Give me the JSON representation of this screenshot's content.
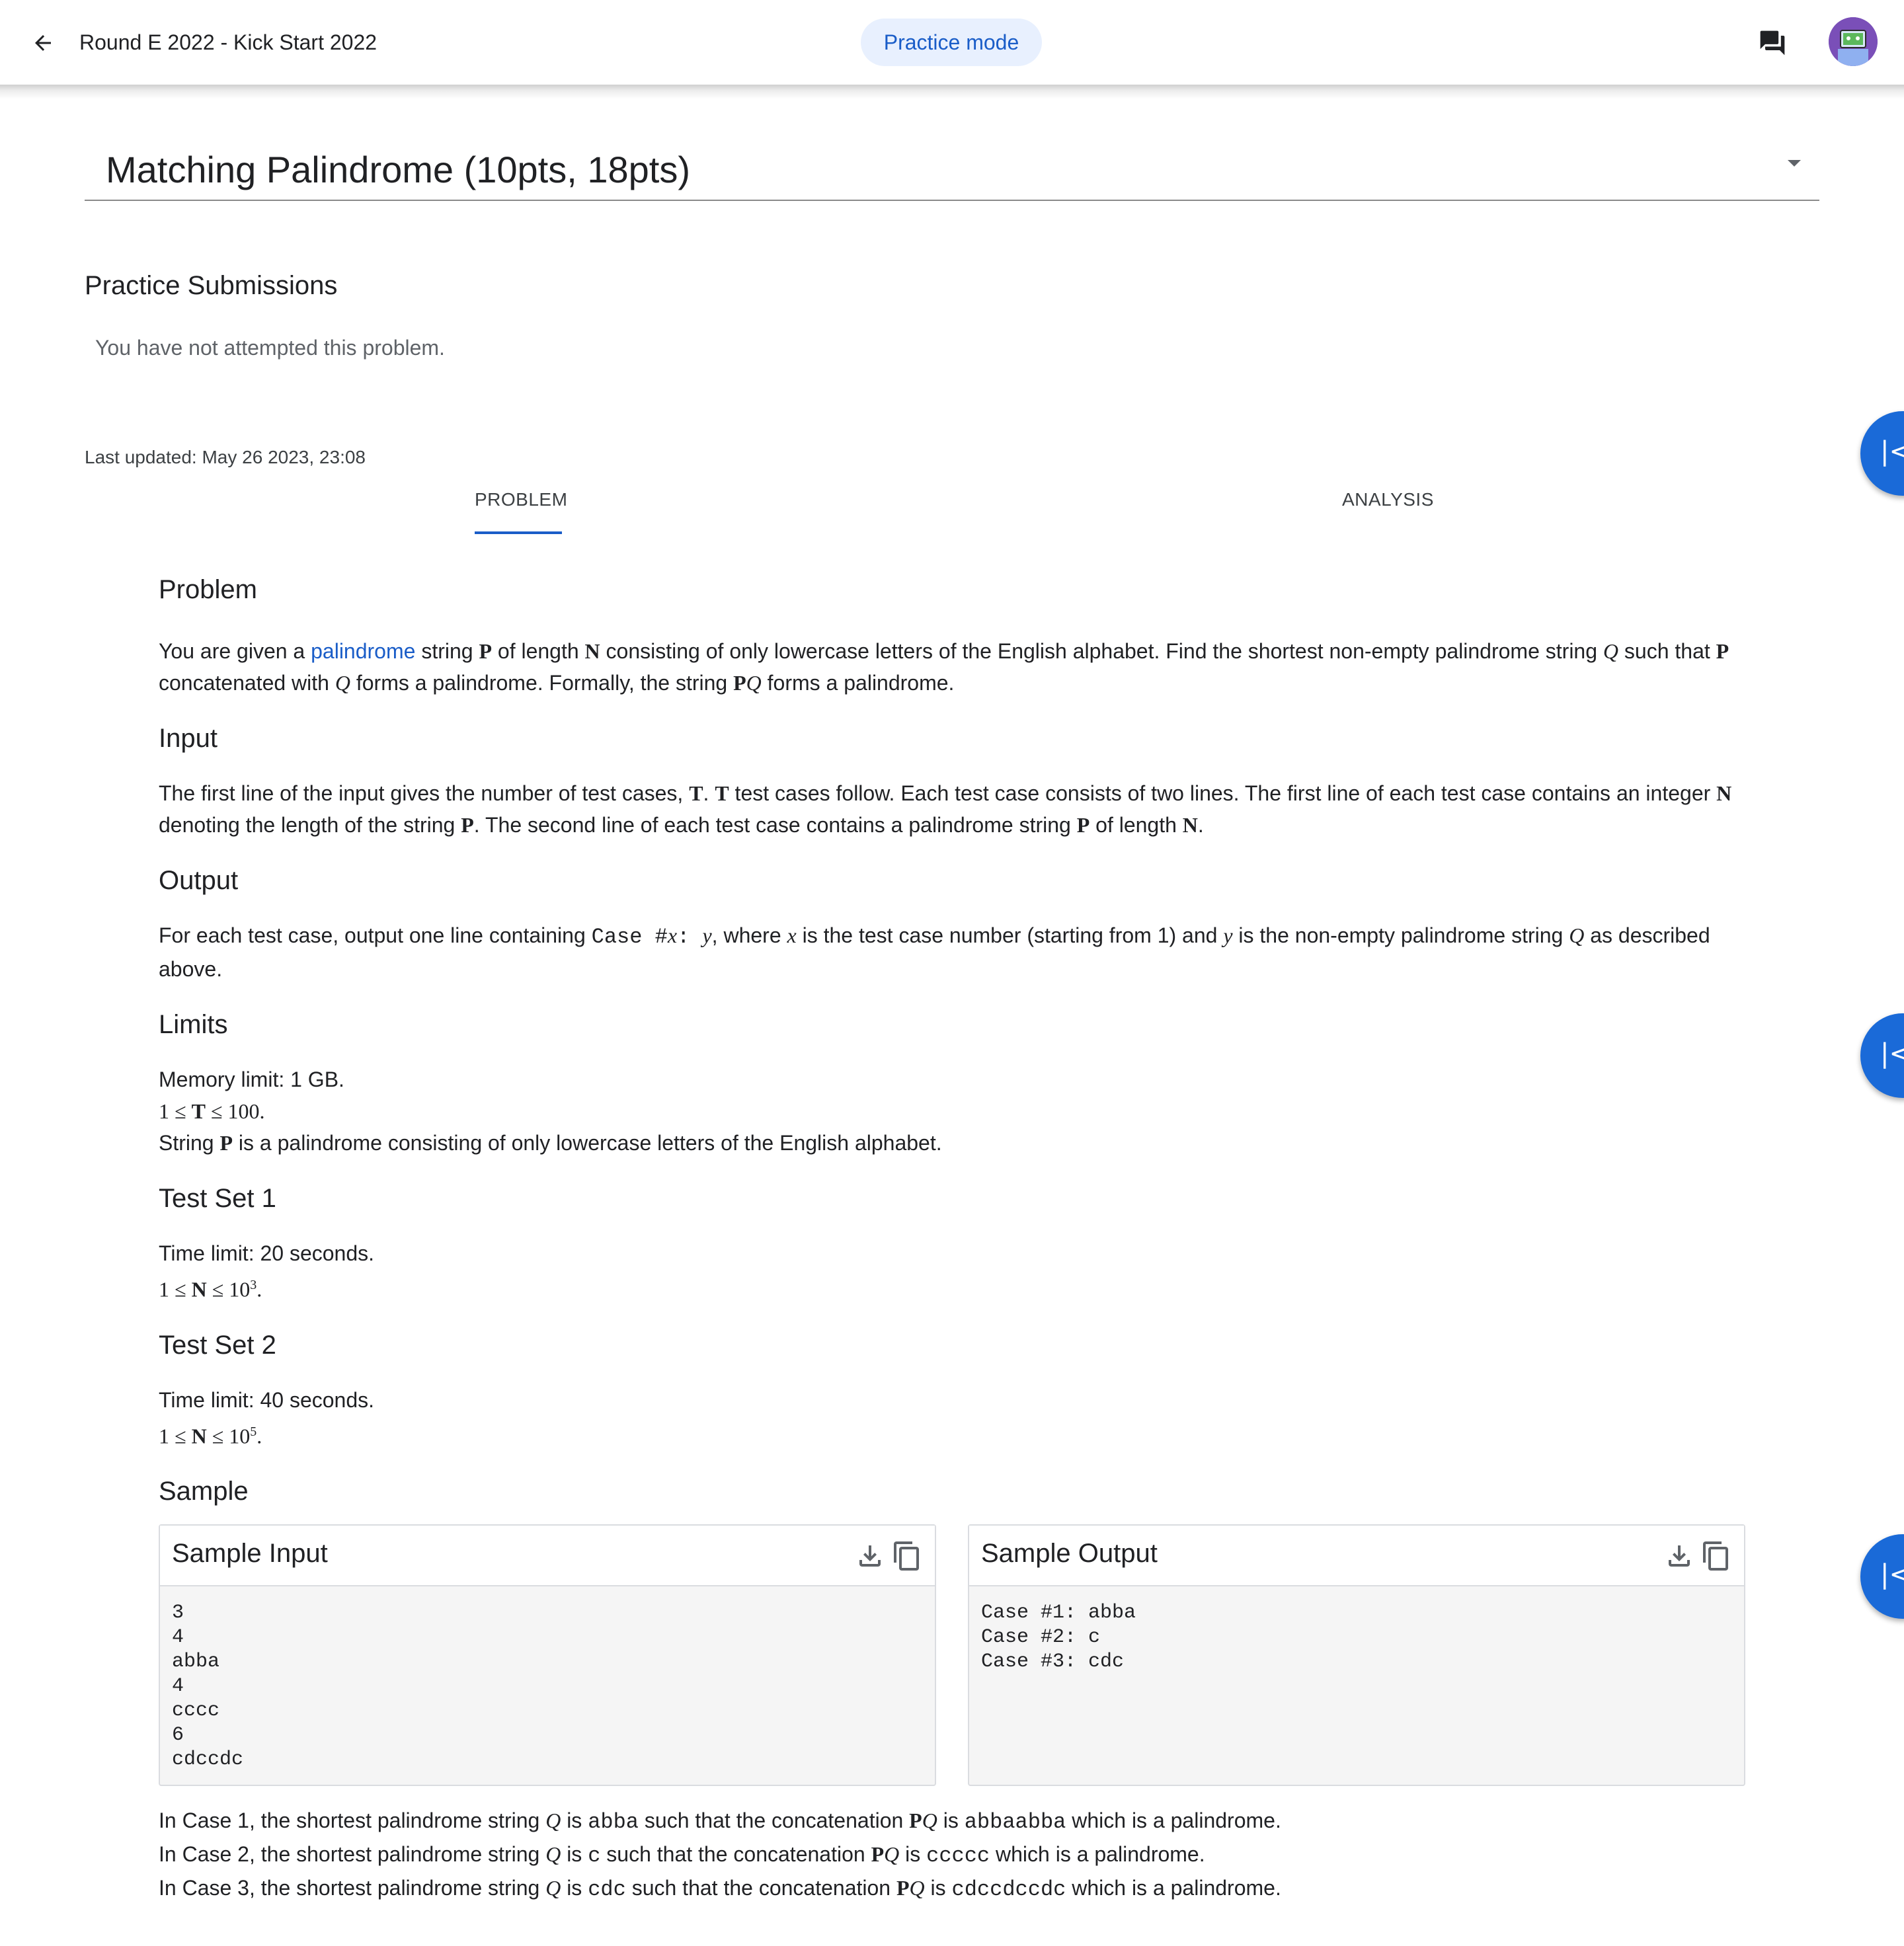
{
  "header": {
    "title": "Round E 2022 - Kick Start 2022",
    "mode": "Practice mode"
  },
  "problem_select": {
    "title": "Matching Palindrome (10pts, 18pts)"
  },
  "submissions": {
    "heading": "Practice Submissions",
    "empty": "You have not attempted this problem."
  },
  "last_updated": "Last updated: May 26 2023, 23:08",
  "tabs": {
    "problem": "PROBLEM",
    "analysis": "ANALYSIS"
  },
  "statement": {
    "problem_heading": "Problem",
    "problem_text": {
      "p1": "You are given a ",
      "link": "palindrome",
      "p2": " string ",
      "v_p": "P",
      "p3": " of length ",
      "v_n": "N",
      "p4": " consisting of only lowercase letters of the English alphabet. Find the shortest non-empty palindrome string ",
      "v_q": "Q",
      "p5": " such that ",
      "p6": " concatenated with ",
      "p7": " forms a palindrome. Formally, the string ",
      "v_pq_p": "P",
      "v_pq_q": "Q",
      "p8": " forms a palindrome."
    },
    "input_heading": "Input",
    "input_text": {
      "s1": "The first line of the input gives the number of test cases, ",
      "v_t": "T",
      "s2": ". ",
      "s3": " test cases follow. Each test case consists of two lines. The first line of each test case contains an integer ",
      "v_n": "N",
      "s4": " denoting the length of the string ",
      "v_p": "P",
      "s5": ". The second line of each test case contains a palindrome string ",
      "s6": " of length ",
      "s7": "."
    },
    "output_heading": "Output",
    "output_text": {
      "o1": "For each test case, output one line containing ",
      "code1": "Case #",
      "v_x": "x",
      "code2": ": ",
      "v_y": "y",
      "o2": ", where ",
      "o3": " is the test case number (starting from 1) and ",
      "o4": " is the non-empty palindrome string ",
      "v_q": "Q",
      "o5": " as described above."
    },
    "limits_heading": "Limits",
    "limits": {
      "memory": "Memory limit: 1 GB.",
      "t_prefix": "1 ≤ ",
      "t_var": "T",
      "t_suffix": " ≤ 100.",
      "string_pre": "String ",
      "string_var": "P",
      "string_post": " is a palindrome consisting of only lowercase letters of the English alphabet."
    },
    "ts1_heading": "Test Set 1",
    "ts1": {
      "time": "Time limit: 20 seconds.",
      "pre": "1 ≤ ",
      "var": "N",
      "mid": " ≤ 10",
      "exp": "3",
      "post": "."
    },
    "ts2_heading": "Test Set 2",
    "ts2": {
      "time": "Time limit: 40 seconds.",
      "pre": "1 ≤ ",
      "var": "N",
      "mid": " ≤ 10",
      "exp": "5",
      "post": "."
    },
    "sample_heading": "Sample"
  },
  "sample_input": {
    "title": "Sample Input",
    "text": "3\n4\nabba\n4\ncccc\n6\ncdccdc"
  },
  "sample_output": {
    "title": "Sample Output",
    "text": "Case #1: abba\nCase #2: c\nCase #3: cdc"
  },
  "explanations": [
    {
      "pre": "In Case 1, the shortest palindrome string ",
      "q": "Q",
      "is1": " is ",
      "ans": "abba",
      "mid": " such that the concatenation ",
      "p": "P",
      "q2": "Q",
      "is2": " is ",
      "concat": "abbaabba",
      "post": " which is a palindrome."
    },
    {
      "pre": "In Case 2, the shortest palindrome string ",
      "q": "Q",
      "is1": " is ",
      "ans": "c",
      "mid": " such that the concatenation ",
      "p": "P",
      "q2": "Q",
      "is2": " is ",
      "concat": "ccccc",
      "post": " which is a palindrome."
    },
    {
      "pre": "In Case 3, the shortest palindrome string ",
      "q": "Q",
      "is1": " is ",
      "ans": "cdc",
      "mid": " such that the concatenation ",
      "p": "P",
      "q2": "Q",
      "is2": " is ",
      "concat": "cdccdccdc",
      "post": " which is a palindrome."
    }
  ],
  "icons": {
    "back": "arrow-back-icon",
    "chat": "chat-icon",
    "download": "download-icon",
    "copy": "copy-icon",
    "collapse": "collapse-left-icon"
  },
  "colors": {
    "accent": "#1a5dc8",
    "pill_bg": "#e8f0fe",
    "side_button": "#1a6ad8"
  }
}
